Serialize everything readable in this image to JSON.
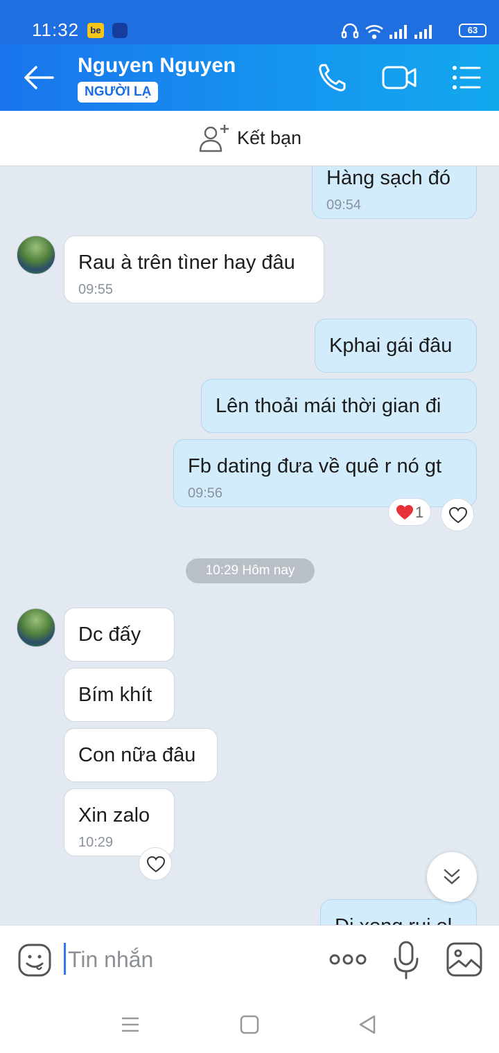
{
  "status_bar": {
    "time": "11:32",
    "be_label": "be",
    "battery": "63"
  },
  "header": {
    "title": "Nguyen Nguyen",
    "badge": "NGƯỜI LẠ"
  },
  "add_friend": {
    "label": "Kết bạn"
  },
  "messages": [
    {
      "dir": "out",
      "text": "Hàng sạch đó",
      "time": "09:54"
    },
    {
      "dir": "in",
      "text": "Rau à trên tìner hay đâu",
      "time": "09:55"
    },
    {
      "dir": "out",
      "text": "Kphai gái đâu"
    },
    {
      "dir": "out",
      "text": "Lên thoải mái thời gian đi"
    },
    {
      "dir": "out",
      "text": "Fb dating đưa về quê r nó gt",
      "time": "09:56",
      "reaction_count": "1"
    },
    {
      "dir": "in",
      "text": "Dc đấy"
    },
    {
      "dir": "in",
      "text": "Bím khít"
    },
    {
      "dir": "in",
      "text": "Con nữa đâu"
    },
    {
      "dir": "in",
      "text": "Xin zalo",
      "time": "10:29"
    },
    {
      "dir": "out",
      "text": "Đi xong rui ol"
    }
  ],
  "date_divider": "10:29 Hôm nay",
  "input": {
    "placeholder": "Tin nhắn"
  },
  "colors": {
    "header": "#1a74ec",
    "outgoing_bubble": "#d3ecfc",
    "incoming_bubble": "#ffffff",
    "chat_bg": "#e2e9f1"
  }
}
